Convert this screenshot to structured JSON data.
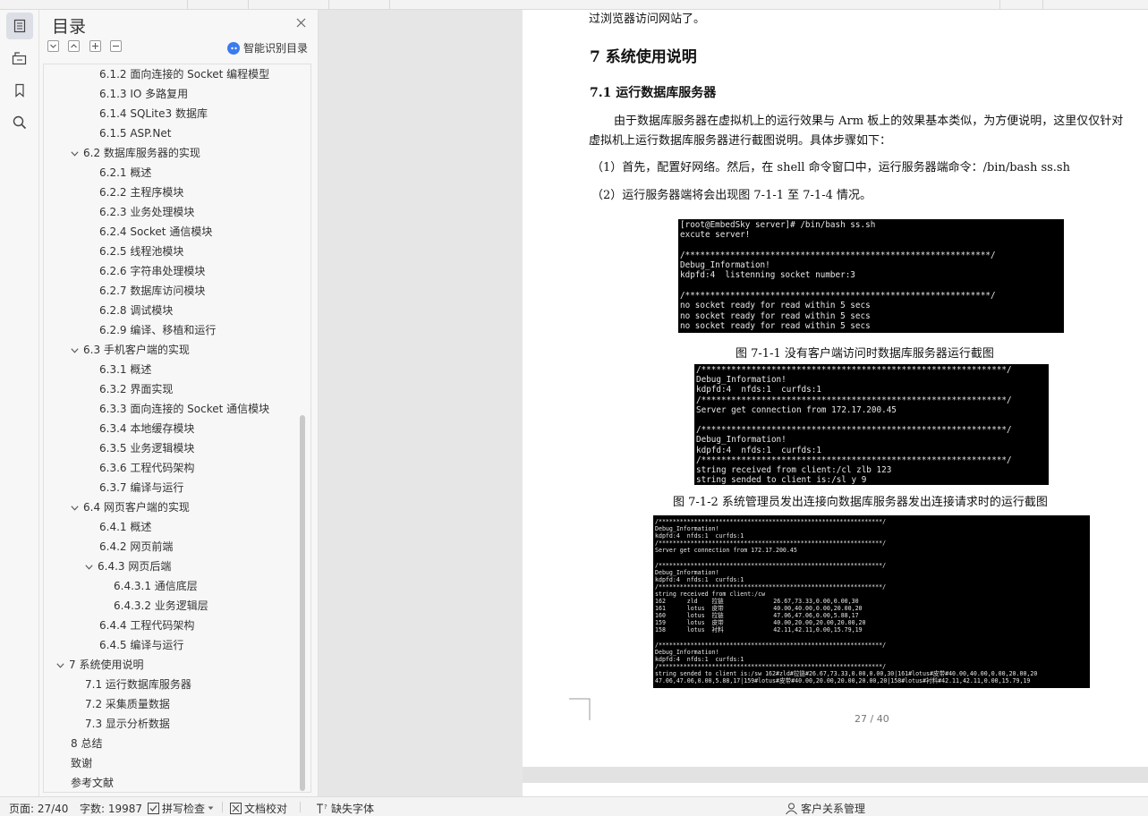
{
  "toc": {
    "title": "目录",
    "ai_label": "智能识别目录",
    "items": [
      {
        "label": "6.1.2 面向连接的 Socket 编程模型",
        "level": 3
      },
      {
        "label": "6.1.3 IO 多路复用",
        "level": 3
      },
      {
        "label": "6.1.4 SQLite3 数据库",
        "level": 3
      },
      {
        "label": "6.1.5 ASP.Net",
        "level": 3
      },
      {
        "label": "6.2 数据库服务器的实现",
        "level": 2,
        "expanded": true
      },
      {
        "label": "6.2.1 概述",
        "level": 3
      },
      {
        "label": "6.2.2 主程序模块",
        "level": 3
      },
      {
        "label": "6.2.3 业务处理模块",
        "level": 3
      },
      {
        "label": "6.2.4 Socket 通信模块",
        "level": 3
      },
      {
        "label": "6.2.5 线程池模块",
        "level": 3
      },
      {
        "label": "6.2.6 字符串处理模块",
        "level": 3
      },
      {
        "label": "6.2.7 数据库访问模块",
        "level": 3
      },
      {
        "label": "6.2.8 调试模块",
        "level": 3
      },
      {
        "label": "6.2.9  编译、移植和运行",
        "level": 3
      },
      {
        "label": "6.3 手机客户端的实现",
        "level": 2,
        "expanded": true
      },
      {
        "label": "6.3.1 概述",
        "level": 3
      },
      {
        "label": "6.3.2 界面实现",
        "level": 3
      },
      {
        "label": "6.3.3 面向连接的 Socket 通信模块",
        "level": 3
      },
      {
        "label": "6.3.4 本地缓存模块",
        "level": 3
      },
      {
        "label": "6.3.5 业务逻辑模块",
        "level": 3
      },
      {
        "label": "6.3.6 工程代码架构",
        "level": 3
      },
      {
        "label": "6.3.7 编译与运行",
        "level": 3
      },
      {
        "label": "6.4 网页客户端的实现",
        "level": 2,
        "expanded": true
      },
      {
        "label": "6.4.1 概述",
        "level": 3
      },
      {
        "label": "6.4.2 网页前端",
        "level": 3
      },
      {
        "label": "6.4.3 网页后端",
        "level": 3,
        "expanded": true
      },
      {
        "label": "6.4.3.1 通信底层",
        "level": 4
      },
      {
        "label": "6.4.3.2 业务逻辑层",
        "level": 4
      },
      {
        "label": "6.4.4 工程代码架构",
        "level": 3
      },
      {
        "label": "6.4.5 编译与运行",
        "level": 3
      },
      {
        "label": "7  系统使用说明",
        "level": 1,
        "expanded": true
      },
      {
        "label": "7.1 运行数据库服务器",
        "level": 2
      },
      {
        "label": "7.2 采集质量数据",
        "level": 2
      },
      {
        "label": "7.3 显示分析数据",
        "level": 2
      },
      {
        "label": "8 总结",
        "level": 1
      },
      {
        "label": "致谢",
        "level": 1
      },
      {
        "label": "参考文献",
        "level": 1
      }
    ]
  },
  "doc": {
    "top_line": "过浏览器访问网站了。",
    "h1": "7  系统使用说明",
    "h2": "7.1 运行数据库服务器",
    "para1_line1": "由于数据库服务器在虚拟机上的运行效果与 Arm 板上的效果基本类似，为方便说明，这里仅仅针对",
    "para1_line2": "虚拟机上运行数据库服务器进行截图说明。具体步骤如下：",
    "step1": "（1）首先，配置好网络。然后，在 shell 命令窗口中，运行服务器端命令：/bin/bash ss.sh",
    "step2": "（2）运行服务器端将会出现图 7-1-1 至 7-1-4 情况。",
    "caption1": "图 7-1-1 没有客户端访问时数据库服务器运行截图",
    "caption2": "图 7-1-2 系统管理员发出连接向数据库服务器发出连接请求时的运行截图",
    "page_number": "27 / 40"
  },
  "terminal1": "[root@EmbedSky server]# /bin/bash ss.sh\nexcute server!\n\n/*************************************************************/\nDebug_Information!\nkdpfd:4  listenning socket number:3\n\n/*************************************************************/\nno socket ready for read within 5 secs\nno socket ready for read within 5 secs\nno socket ready for read within 5 secs",
  "terminal2": "/*************************************************************/\nDebug_Information!\nkdpfd:4  nfds:1  curfds:1\n/*************************************************************/\nServer get connection from 172.17.200.45\n\n/*************************************************************/\nDebug_Information!\nkdpfd:4  nfds:1  curfds:1\n/*************************************************************/\nstring received from client:/cl zlb 123\nstring sended to client is:/sl y 9",
  "terminal3": "/***************************************************************/\nDebug_Information!\nkdpfd:4  nfds:1  curfds:1\n/***************************************************************/\nServer get connection from 172.17.200.45\n\n/***************************************************************/\nDebug_Information!\nkdpfd:4  nfds:1  curfds:1\n/***************************************************************/\nstring received from client:/cw\n162      zld    拉链              26.67,73.33,0.00,0.00,30\n161      lotus  皮带              40.00,40.00,0.00,20.00,20\n160      lotus  拉链              47.06,47.06,0.00,5.88,17\n159      lotus  皮带              40.00,20.00,20.00,20.00,20\n158      lotus  衬料              42.11,42.11,0.00,15.79,19\n\n/***************************************************************/\nDebug_Information!\nkdpfd:4  nfds:1  curfds:1\n/***************************************************************/\nstring sended to client is:/sw 162#zld#拉链#26.67,73.33,0.00,0.00,30|161#lotus#皮带#40.00,40.00,0.00,20.00,20\n47.06,47.06,0.00,5.88,17|159#lotus#皮带#40.00,20.00,20.00,20.00,20|158#lotus#衬料#42.11,42.11,0.00,15.79,19",
  "status": {
    "page": "页面: 27/40",
    "words": "字数: 19987",
    "spell": "拼写检查",
    "proof": "文档校对",
    "missing_font": "缺失字体",
    "crm": "客户关系管理"
  }
}
